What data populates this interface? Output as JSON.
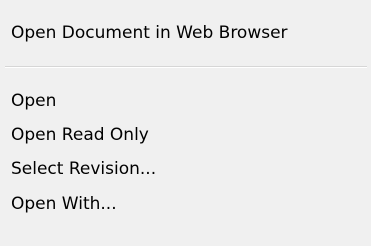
{
  "context_menu": {
    "header_item": {
      "label": "Open Document in Web Browser"
    },
    "items": [
      {
        "label": "Open"
      },
      {
        "label": "Open Read Only"
      },
      {
        "label": "Select Revision..."
      },
      {
        "label": "Open With..."
      }
    ]
  },
  "colors": {
    "menu_background": "#f0f0f0",
    "separator": "#d6d6d6",
    "text": "#000000"
  }
}
